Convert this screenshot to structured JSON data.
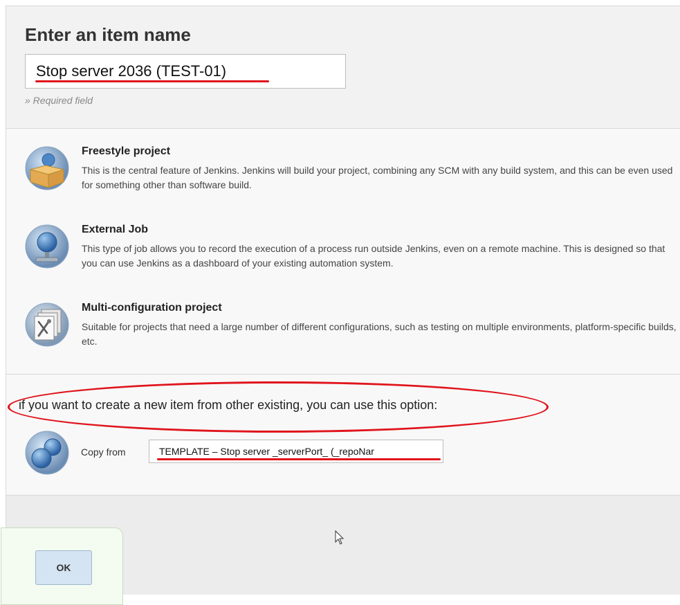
{
  "header": {
    "title": "Enter an item name",
    "item_name_value": "Stop server 2036 (TEST-01)",
    "required_label": "» Required field"
  },
  "item_types": [
    {
      "title": "Freestyle project",
      "description": "This is the central feature of Jenkins. Jenkins will build your project, combining any SCM with any build system, and this can be even used for something other than software build.",
      "icon": "freestyle-project-icon"
    },
    {
      "title": "External Job",
      "description": "This type of job allows you to record the execution of a process run outside Jenkins, even on a remote machine. This is designed so that you can use Jenkins as a dashboard of your existing automation system.",
      "icon": "external-job-icon"
    },
    {
      "title": "Multi-configuration project",
      "description": "Suitable for projects that need a large number of different configurations, such as testing on multiple environments, platform-specific builds, etc.",
      "icon": "multi-configuration-icon"
    }
  ],
  "copy": {
    "hint": "if you want to create a new item from other existing, you can use this option:",
    "label": "Copy from",
    "value": "TEMPLATE – Stop server _serverPort_ (_repoNar",
    "icon": "copy-item-icon"
  },
  "footer": {
    "ok_label": "OK"
  },
  "colors": {
    "annotation_red": "#e0141c",
    "ok_button_bg": "#d5e4f3"
  }
}
